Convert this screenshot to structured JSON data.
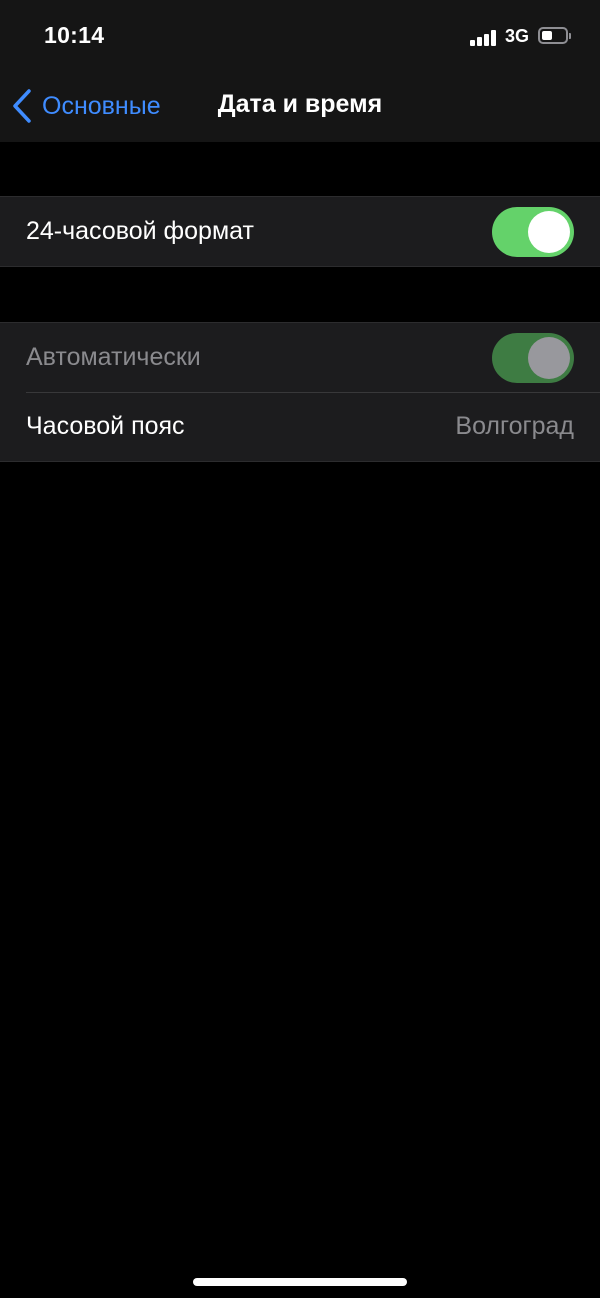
{
  "status_bar": {
    "time": "10:14",
    "network": "3G",
    "signal_bars_filled": 4,
    "battery_level": 0.45
  },
  "nav": {
    "back_label": "Основные",
    "title": "Дата и время",
    "accent_color": "#3f8cff"
  },
  "settings": {
    "format_24h": {
      "label": "24-часовой формат",
      "on": true
    },
    "automatic": {
      "label": "Автоматически",
      "on": true,
      "enabled": false
    },
    "timezone": {
      "label": "Часовой пояс",
      "value": "Волгоград"
    }
  },
  "colors": {
    "toggle_on": "#64d26a",
    "toggle_on_disabled": "#3e7c43",
    "background": "#000000",
    "cell": "#1c1c1e"
  }
}
